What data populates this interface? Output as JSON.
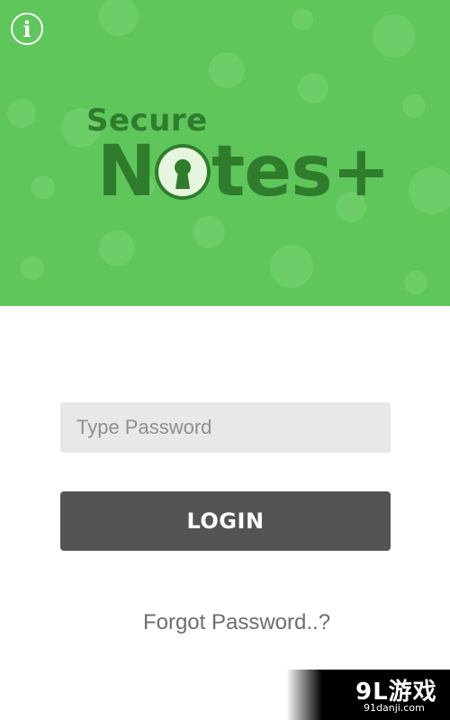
{
  "header": {
    "background_color": "#5ec65a",
    "info_button": {
      "label": "i",
      "icon": "info-icon"
    }
  },
  "logo": {
    "line1": "Secure",
    "line2_prefix": "N",
    "line2_suffix": "tes+",
    "keyhole_icon": "keyhole-icon",
    "text_color": "#2f7d2c"
  },
  "form": {
    "password_placeholder": "Type Password",
    "password_value": "",
    "login_label": "LOGIN",
    "forgot_label": "Forgot Password..?",
    "button_color": "#545454"
  },
  "watermark": {
    "main": "9L游戏",
    "sub": "91danji.com"
  }
}
